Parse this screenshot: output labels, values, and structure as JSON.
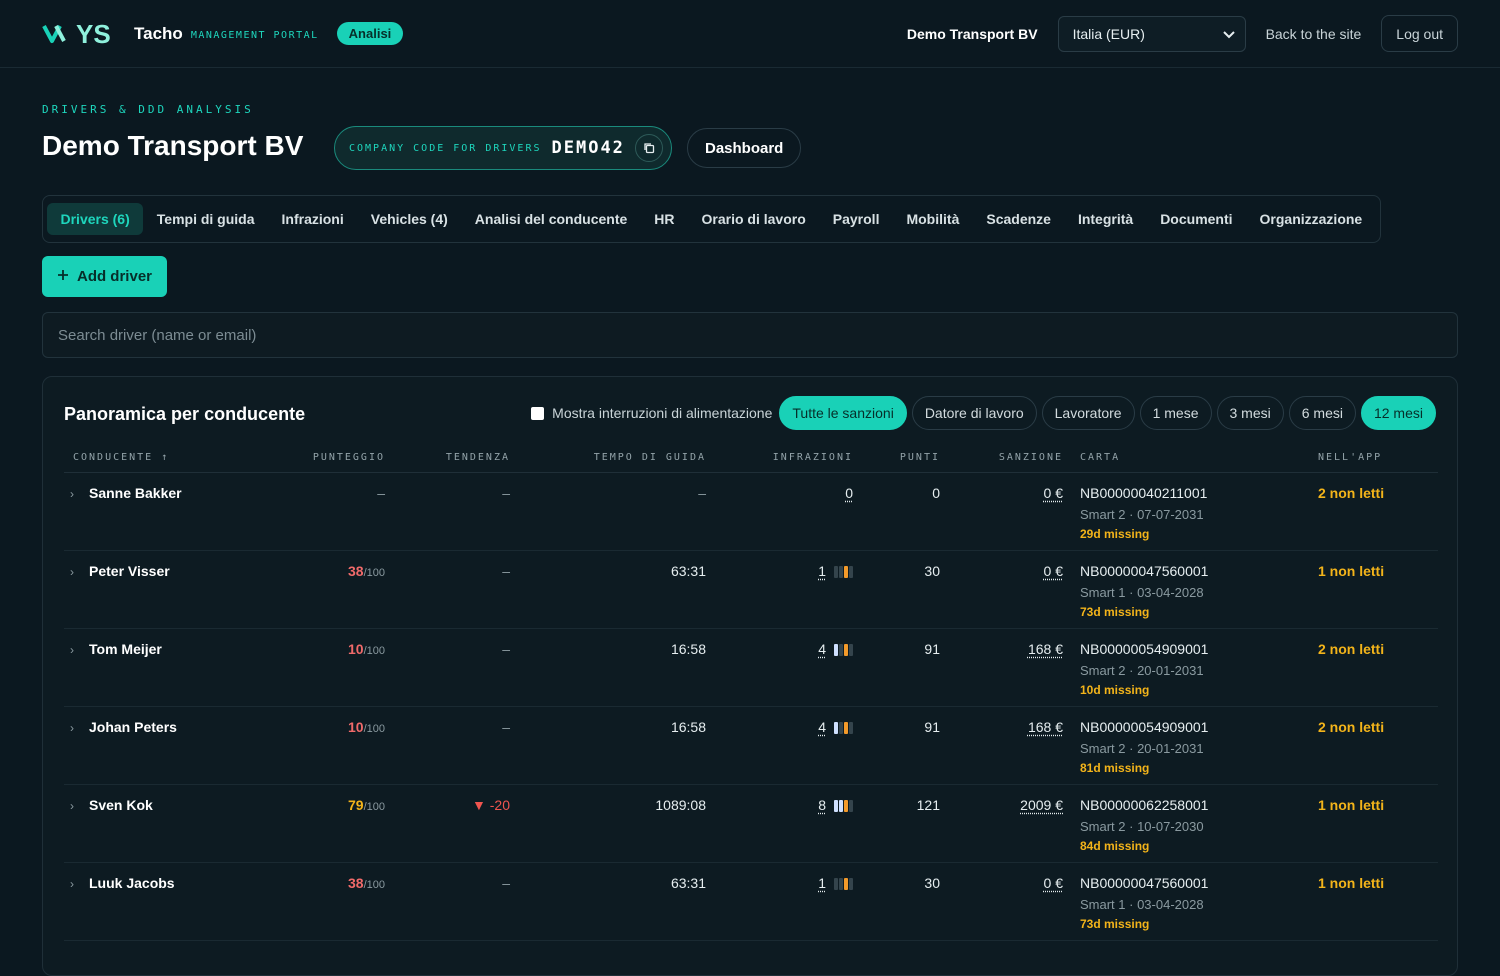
{
  "header": {
    "brand_mark": "YS",
    "brand_name": "Tacho",
    "brand_sub": "MANAGEMENT PORTAL",
    "mode_badge": "Analisi",
    "company": "Demo Transport BV",
    "region_select": "Italia (EUR)",
    "back_link": "Back to the site",
    "logout": "Log out"
  },
  "page": {
    "eyebrow": "DRIVERS & DDD ANALYSIS",
    "title": "Demo Transport BV",
    "code_label": "COMPANY CODE FOR DRIVERS",
    "code_value": "DEMO42",
    "dashboard_button": "Dashboard"
  },
  "tabs": [
    {
      "label": "Drivers (6)",
      "active": true
    },
    {
      "label": "Tempi di guida"
    },
    {
      "label": "Infrazioni"
    },
    {
      "label": "Vehicles (4)"
    },
    {
      "label": "Analisi del conducente"
    },
    {
      "label": "HR"
    },
    {
      "label": "Orario di lavoro"
    },
    {
      "label": "Payroll"
    },
    {
      "label": "Mobilità"
    },
    {
      "label": "Scadenze"
    },
    {
      "label": "Integrità"
    },
    {
      "label": "Documenti"
    },
    {
      "label": "Organizzazione"
    }
  ],
  "add_driver": "Add driver",
  "search": {
    "placeholder": "Search driver (name or email)"
  },
  "panel": {
    "title": "Panoramica per conducente",
    "checkbox_label": "Mostra interruzioni di alimentazione",
    "sanction_filters": [
      "Tutte le sanzioni",
      "Datore di lavoro",
      "Lavoratore"
    ],
    "period_filters": [
      "1 mese",
      "3 mesi",
      "6 mesi",
      "12 mesi"
    ],
    "active_sanction": "Tutte le sanzioni",
    "active_period": "12 mesi"
  },
  "table": {
    "headers": {
      "driver": "CONDUCENTE ↑",
      "score": "PUNTEGGIO",
      "trend": "TENDENZA",
      "drive_time": "TEMPO DI GUIDA",
      "infractions": "INFRAZIONI",
      "points": "PUNTI",
      "sanction": "SANZIONE",
      "card": "CARTA",
      "in_app": "NELL'APP"
    },
    "rows": [
      {
        "name": "Sanne Bakker",
        "score": "–",
        "score_den": "",
        "trend": "–",
        "drive_time": "–",
        "infractions": "0",
        "points": "0",
        "sanction": "0 €",
        "card_number": "NB00000040211001",
        "card_info": "Smart 2 · 07-07-2031",
        "card_missing": "29d missing",
        "app": "2 non letti"
      },
      {
        "name": "Peter Visser",
        "score": "38",
        "score_den": "/100",
        "trend": "–",
        "drive_time": "63:31",
        "infractions": "1",
        "points": "30",
        "sanction": "0 €",
        "card_number": "NB00000047560001",
        "card_info": "Smart 1 · 03-04-2028",
        "card_missing": "73d missing",
        "app": "1 non letti"
      },
      {
        "name": "Tom Meijer",
        "score": "10",
        "score_den": "/100",
        "trend": "–",
        "drive_time": "16:58",
        "infractions": "4",
        "points": "91",
        "sanction": "168 €",
        "card_number": "NB00000054909001",
        "card_info": "Smart 2 · 20-01-2031",
        "card_missing": "10d missing",
        "app": "2 non letti"
      },
      {
        "name": "Johan Peters",
        "score": "10",
        "score_den": "/100",
        "trend": "–",
        "drive_time": "16:58",
        "infractions": "4",
        "points": "91",
        "sanction": "168 €",
        "card_number": "NB00000054909001",
        "card_info": "Smart 2 · 20-01-2031",
        "card_missing": "81d missing",
        "app": "2 non letti"
      },
      {
        "name": "Sven Kok",
        "score": "79",
        "score_den": "/100",
        "trend": "▼ -20",
        "drive_time": "1089:08",
        "infractions": "8",
        "points": "121",
        "sanction": "2009 €",
        "card_number": "NB00000062258001",
        "card_info": "Smart 2 · 10-07-2030",
        "card_missing": "84d missing",
        "app": "1 non letti"
      },
      {
        "name": "Luuk Jacobs",
        "score": "38",
        "score_den": "/100",
        "trend": "–",
        "drive_time": "63:31",
        "infractions": "1",
        "points": "30",
        "sanction": "0 €",
        "card_number": "NB00000047560001",
        "card_info": "Smart 1 · 03-04-2028",
        "card_missing": "73d missing",
        "app": "1 non letti"
      }
    ]
  },
  "colors": {
    "accent": "#19d1b7",
    "score_low": "#f06a6a",
    "score_mid": "#f3b41a",
    "trend_down": "#f0554f",
    "warning": "#f3b41a",
    "bar_grey": "#34444c",
    "bar_blue": "#cfe0ff",
    "bar_orange": "#f39a2a"
  }
}
